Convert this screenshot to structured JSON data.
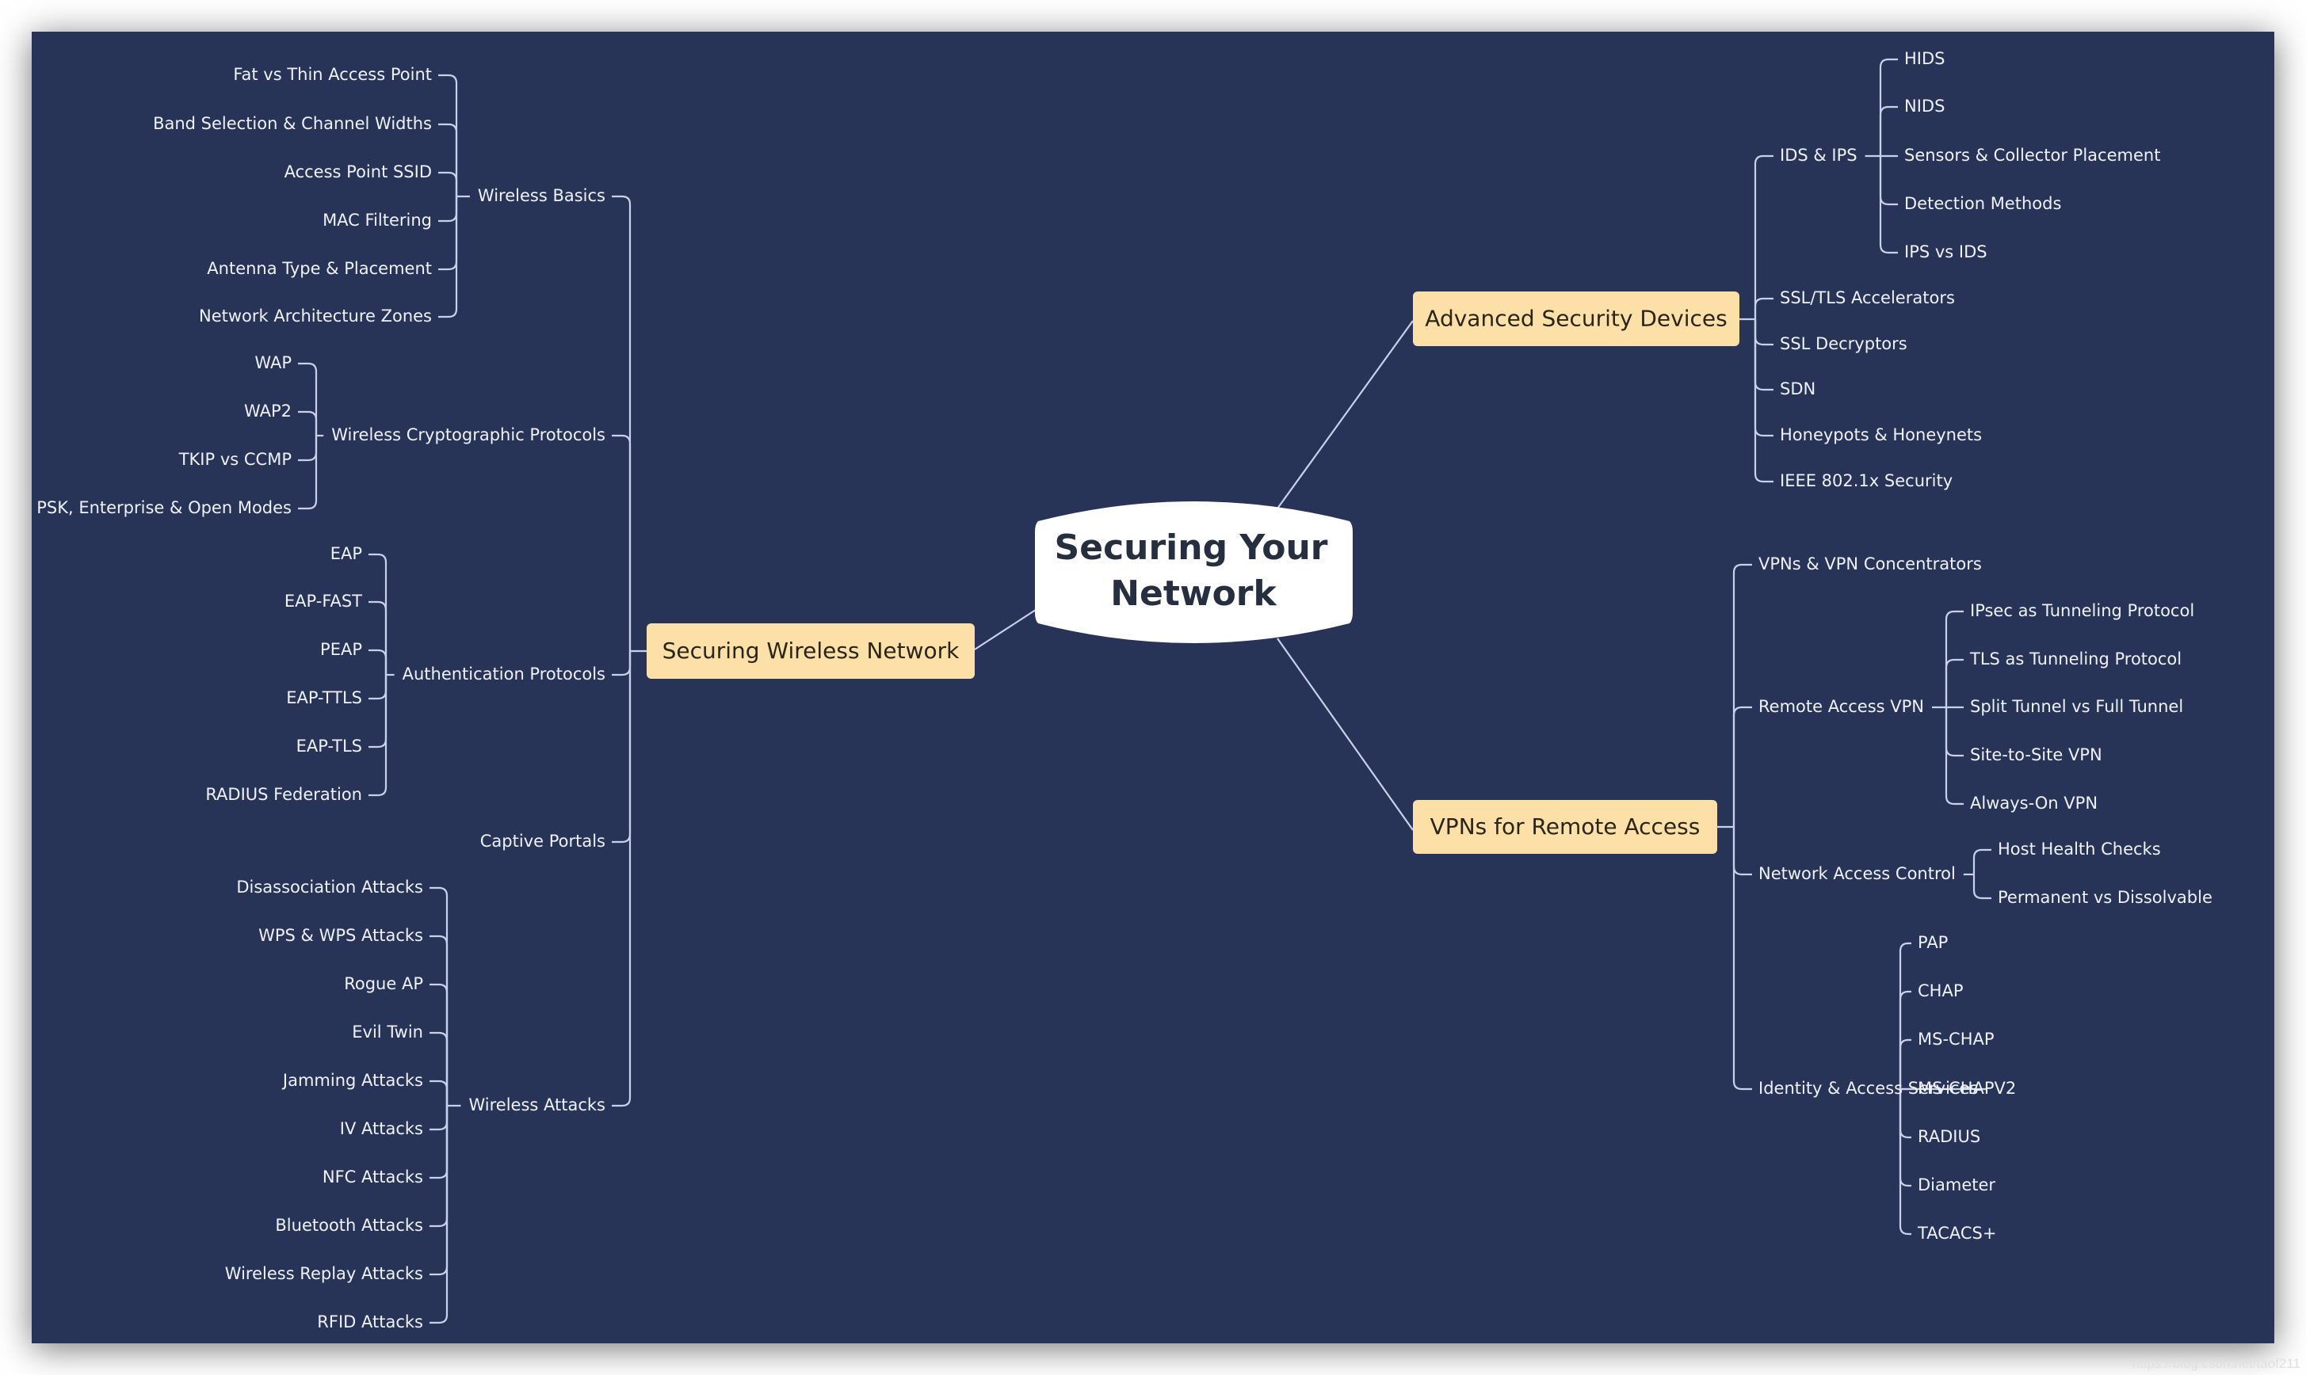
{
  "colors": {
    "canvas_bg": "#283457",
    "page_bg": "#ffffff",
    "root_fill": "#ffffff",
    "root_text": "#262f40",
    "branch_fill": "#fde0a8",
    "branch_text": "#2b2418",
    "leaf_text": "#eef1f8",
    "connector": "#c9d1ea"
  },
  "root": {
    "line1": "Securing Your",
    "line2": "Network"
  },
  "branches": {
    "wireless": {
      "label": "Securing Wireless Network",
      "topics": {
        "basics": {
          "label": "Wireless Basics",
          "items": [
            "Fat vs Thin Access Point",
            "Band Selection & Channel Widths",
            "Access Point SSID",
            "MAC Filtering",
            "Antenna Type & Placement",
            "Network Architecture Zones"
          ]
        },
        "crypto": {
          "label": "Wireless Cryptographic Protocols",
          "items": [
            "WAP",
            "WAP2",
            "TKIP vs CCMP",
            "PSK, Enterprise & Open Modes"
          ]
        },
        "auth": {
          "label": "Authentication Protocols",
          "items": [
            "EAP",
            "EAP-FAST",
            "PEAP",
            "EAP-TTLS",
            "EAP-TLS",
            "RADIUS Federation"
          ]
        },
        "captive": {
          "label": "Captive Portals",
          "items": []
        },
        "attacks": {
          "label": "Wireless Attacks",
          "items": [
            "Disassociation Attacks",
            "WPS & WPS Attacks",
            "Rogue AP",
            "Evil Twin",
            "Jamming Attacks",
            "IV Attacks",
            "NFC Attacks",
            "Bluetooth Attacks",
            "Wireless Replay Attacks",
            "RFID Attacks"
          ]
        }
      }
    },
    "advanced": {
      "label": "Advanced Security Devices",
      "topics": {
        "ids": {
          "label": "IDS & IPS",
          "items": [
            "HIDS",
            "NIDS",
            "Sensors & Collector Placement",
            "Detection Methods",
            "IPS vs IDS"
          ]
        },
        "ssltls": {
          "label": "SSL/TLS Accelerators",
          "items": []
        },
        "ssldec": {
          "label": "SSL Decryptors",
          "items": []
        },
        "sdn": {
          "label": "SDN",
          "items": []
        },
        "honey": {
          "label": "Honeypots & Honeynets",
          "items": []
        },
        "ieee": {
          "label": "IEEE 802.1x Security",
          "items": []
        }
      }
    },
    "vpn": {
      "label": "VPNs for Remote Access",
      "topics": {
        "concentrators": {
          "label": "VPNs & VPN Concentrators",
          "items": []
        },
        "remote": {
          "label": "Remote Access VPN",
          "items": [
            "IPsec as Tunneling Protocol",
            "TLS as Tunneling Protocol",
            "Split Tunnel vs Full Tunnel",
            "Site-to-Site VPN",
            "Always-On VPN"
          ]
        },
        "nac": {
          "label": "Network Access Control",
          "items": [
            "Host Health Checks",
            "Permanent vs Dissolvable"
          ]
        },
        "identity": {
          "label": "Identity & Access Services",
          "items": [
            "PAP",
            "CHAP",
            "MS-CHAP",
            "MS-CHAPV2",
            "RADIUS",
            "Diameter",
            "TACACS+"
          ]
        }
      }
    }
  },
  "watermark": "https://blog.csdn.net/taof211"
}
